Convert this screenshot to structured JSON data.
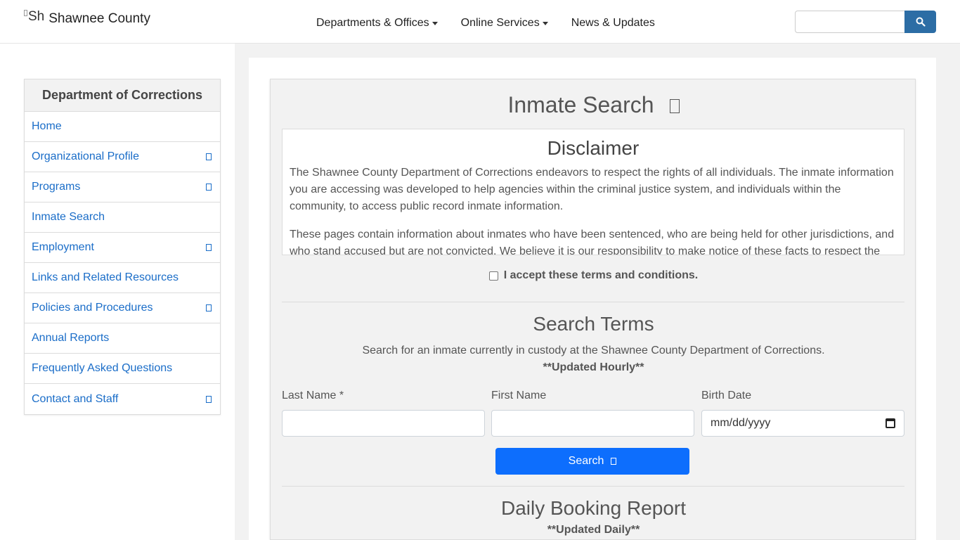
{
  "header": {
    "logo_alt": "Sh",
    "site_name": "Shawnee County",
    "nav": [
      {
        "label": "Departments & Offices",
        "dropdown": true
      },
      {
        "label": "Online Services",
        "dropdown": true
      },
      {
        "label": "News & Updates",
        "dropdown": false
      }
    ],
    "search_placeholder": "",
    "search_icon": "search-icon"
  },
  "sidebar": {
    "title": "Department of Corrections",
    "items": [
      {
        "label": "Home",
        "expandable": false
      },
      {
        "label": "Organizational Profile",
        "expandable": true
      },
      {
        "label": "Programs",
        "expandable": true
      },
      {
        "label": "Inmate Search",
        "expandable": false
      },
      {
        "label": "Employment",
        "expandable": true
      },
      {
        "label": "Links and Related Resources",
        "expandable": false
      },
      {
        "label": "Policies and Procedures",
        "expandable": true
      },
      {
        "label": "Annual Reports",
        "expandable": false
      },
      {
        "label": "Frequently Asked Questions",
        "expandable": false
      },
      {
        "label": "Contact and Staff",
        "expandable": true
      }
    ]
  },
  "main": {
    "title": "Inmate Search",
    "disclaimer": {
      "title": "Disclaimer",
      "paragraphs": [
        "The Shawnee County Department of Corrections endeavors to respect the rights of all individuals. The inmate information you are accessing was developed to help agencies within the criminal justice system, and individuals within the community, to access public record inmate information.",
        "These pages contain information about inmates who have been sentenced, who are being held for other jurisdictions, and who stand accused but are not convicted. We believe it is our responsibility to make notice of these facts to respect the"
      ]
    },
    "accept_label": "I accept these terms and conditions.",
    "search_terms": {
      "title": "Search Terms",
      "description": "Search for an inmate currently in custody at the Shawnee County Department of Corrections.",
      "update_note": "**Updated Hourly**",
      "fields": {
        "last_name_label": "Last Name *",
        "first_name_label": "First Name",
        "birth_date_label": "Birth Date",
        "birth_date_placeholder": "mm/dd/yyyy"
      },
      "search_button": "Search"
    },
    "daily_report": {
      "title": "Daily Booking Report",
      "update_note": "**Updated Daily**"
    }
  },
  "colors": {
    "link": "#1a6dc8",
    "primary_button": "#0d6efd",
    "search_button": "#2c6da5",
    "panel_bg": "#f2f2f2"
  }
}
